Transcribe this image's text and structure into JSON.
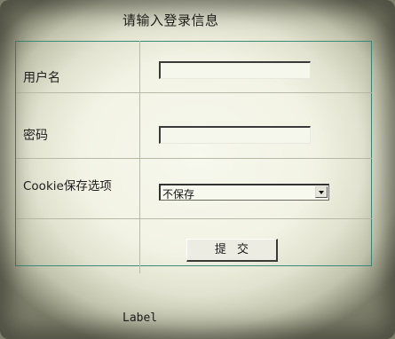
{
  "form": {
    "title": "请输入登录信息",
    "username_label": "用户名",
    "username_value": "",
    "password_label": "密码",
    "password_value": "",
    "cookie_label": "Cookie保存选项",
    "cookie_selected": "不保存",
    "submit_label": "提 交"
  },
  "footer": {
    "label": "Label"
  },
  "icons": {
    "dropdown": "chevron-down-icon"
  }
}
